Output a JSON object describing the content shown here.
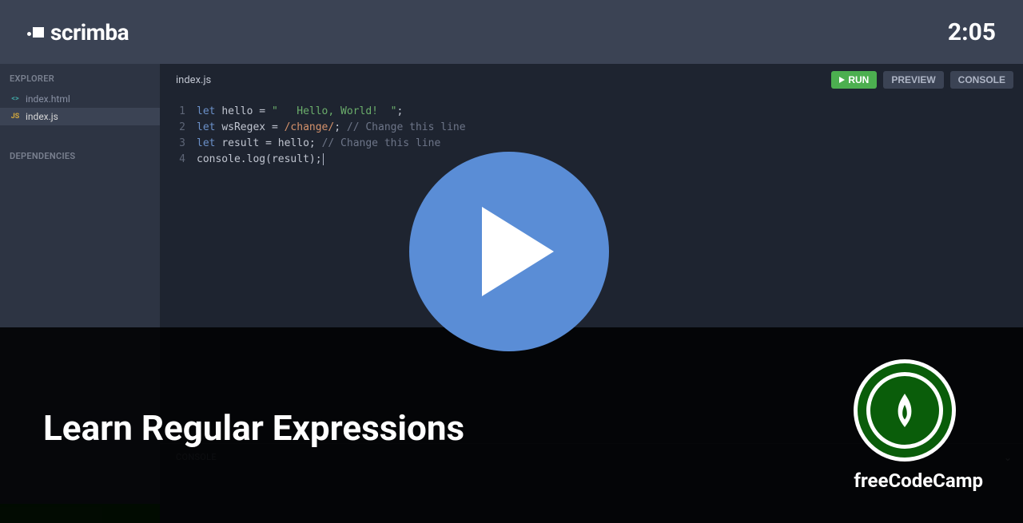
{
  "header": {
    "brand": "scrimba",
    "timer": "2:05"
  },
  "sidebar": {
    "explorer_label": "EXPLORER",
    "dependencies_label": "DEPENDENCIES",
    "files": [
      {
        "name": "index.html",
        "type": "html",
        "active": false
      },
      {
        "name": "index.js",
        "type": "js",
        "active": true
      }
    ]
  },
  "editor": {
    "active_tab": "index.js",
    "buttons": {
      "run": "RUN",
      "preview": "PREVIEW",
      "console": "CONSOLE"
    },
    "code": {
      "line1": {
        "kw": "let",
        "v": "hello",
        "eq": "=",
        "str": "\"   Hello, World!  \"",
        "end": ";"
      },
      "line2": {
        "kw": "let",
        "v": "wsRegex",
        "eq": "=",
        "rx": "/change/",
        "end": ";",
        "cm": "// Change this line"
      },
      "line3": {
        "kw": "let",
        "v": "result",
        "eq": "=",
        "rv": "hello",
        "end": ";",
        "cm": "// Change this line"
      },
      "line4": {
        "obj": "console",
        "dot": ".",
        "fn": "log",
        "open": "(",
        "arg": "result",
        "close": ")",
        "end": ";"
      }
    }
  },
  "console": {
    "label": "CONSOLE"
  },
  "overlay": {
    "title": "Learn Regular Expressions",
    "channel": "freeCodeCamp"
  }
}
